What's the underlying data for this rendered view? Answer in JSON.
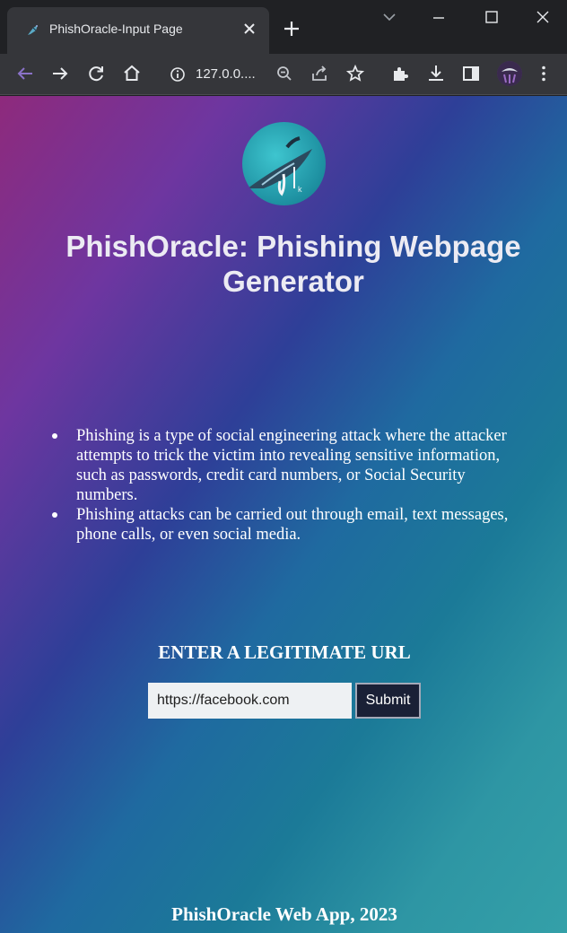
{
  "browser": {
    "tab_title": "PhishOracle-Input Page",
    "address": "127.0.0....",
    "icons": [
      "back-icon",
      "forward-icon",
      "reload-icon",
      "home-icon",
      "site-info-icon",
      "zoom-icon",
      "share-icon",
      "bookmark-star-icon",
      "extensions-icon",
      "download-icon",
      "side-panel-icon",
      "profile-avatar",
      "menu-icon"
    ]
  },
  "page": {
    "title": "PhishOracle: Phishing Webpage Generator",
    "info": [
      "Phishing is a type of social engineering attack where the attacker attempts to trick the victim into revealing sensitive information, such as passwords, credit card numbers, or Social Security numbers.",
      "Phishing attacks can be carried out through email, text messages, phone calls, or even social media."
    ],
    "form": {
      "heading": "ENTER A LEGITIMATE URL",
      "url_value": "https://facebook.com",
      "submit_label": "Submit"
    },
    "footer": "PhishOracle Web App, 2023"
  },
  "colors": {
    "chrome_dark": "#202124",
    "toolbar": "#35363a",
    "gradient_start": "#8e2a7c",
    "gradient_mid": "#2e3f98",
    "gradient_end": "#34a0a8",
    "submit_bg": "#1a2036"
  }
}
